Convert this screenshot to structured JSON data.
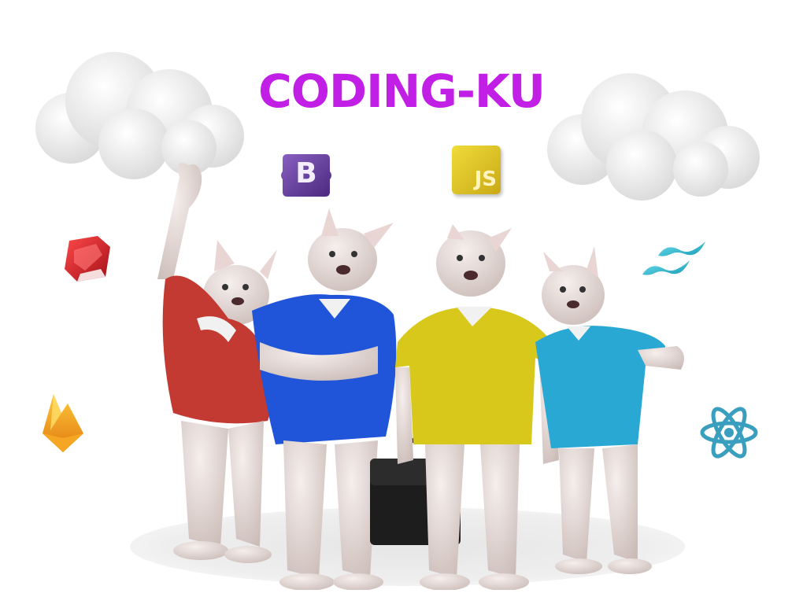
{
  "title": "CODING-KU",
  "colors": {
    "title": "#c21fe6",
    "shirt_red": "#c23a32",
    "shirt_blue": "#2155d9",
    "shirt_yellow": "#d7c81b",
    "shirt_cyan": "#2aa8d4",
    "fur": "#e9dfdc",
    "ground_shadow": "#ececec"
  },
  "logos": {
    "bootstrap_letter": "B",
    "javascript_text": "JS"
  },
  "icons": [
    "cloud-icon",
    "bootstrap-icon",
    "javascript-icon",
    "ruby-icon",
    "tailwind-icon",
    "firebase-icon",
    "react-icon",
    "briefcase-icon"
  ],
  "mascots": [
    "red-shirt",
    "blue-shirt",
    "yellow-shirt",
    "cyan-shirt"
  ]
}
